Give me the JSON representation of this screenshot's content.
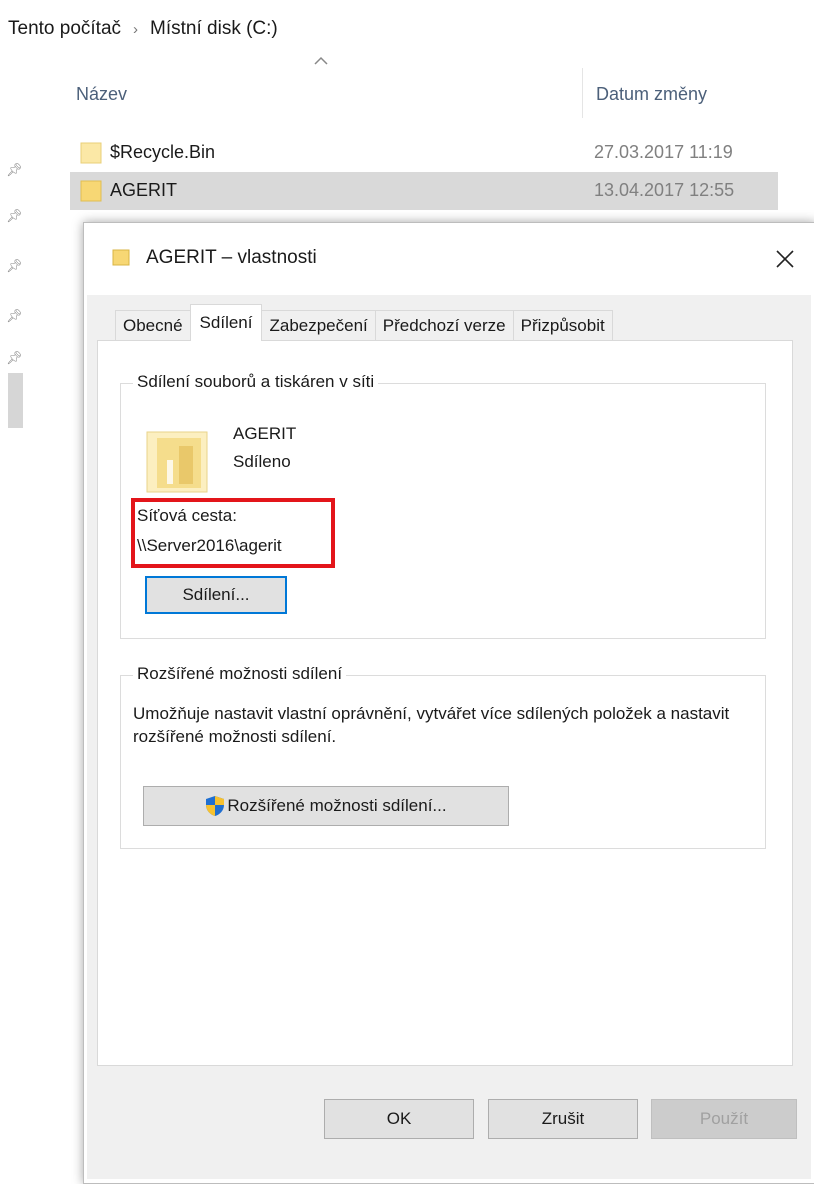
{
  "breadcrumb": {
    "items": [
      "Tento počítač",
      "Místní disk (C:)"
    ],
    "separator": "›"
  },
  "explorer": {
    "columns": {
      "name": "Název",
      "date": "Datum změny"
    },
    "files": [
      {
        "name": "$Recycle.Bin",
        "date": "27.03.2017 11:19",
        "selected": false
      },
      {
        "name": "AGERIT",
        "date": "13.04.2017 12:55",
        "selected": true
      }
    ],
    "pin_icon": "pin-icon"
  },
  "dialog": {
    "title": "AGERIT – vlastnosti",
    "close_icon": "close-icon",
    "tabs": [
      {
        "label": "Obecné",
        "active": false
      },
      {
        "label": "Sdílení",
        "active": true
      },
      {
        "label": "Zabezpečení",
        "active": false
      },
      {
        "label": "Předchozí verze",
        "active": false
      },
      {
        "label": "Přizpůsobit",
        "active": false
      }
    ],
    "network_sharing": {
      "legend": "Sdílení souborů a tiskáren v síti",
      "folder_name": "AGERIT",
      "status": "Sdíleno",
      "path_label": "Síťová cesta:",
      "path_value": "\\\\Server2016\\agerit",
      "share_button": "Sdílení..."
    },
    "advanced_sharing": {
      "legend": "Rozšířené možnosti sdílení",
      "description": "Umožňuje nastavit vlastní oprávnění, vytvářet více sdílených položek a nastavit rozšířené možnosti sdílení.",
      "button": "Rozšířené možnosti sdílení...",
      "button_icon": "uac-shield-icon"
    },
    "footer": {
      "ok": "OK",
      "cancel": "Zrušit",
      "apply": "Použít",
      "apply_enabled": false
    }
  },
  "colors": {
    "highlight": "#e3151a",
    "default_button_border": "#0078d7",
    "folder": "#f7d774",
    "selected_row": "#d9d9d9"
  }
}
